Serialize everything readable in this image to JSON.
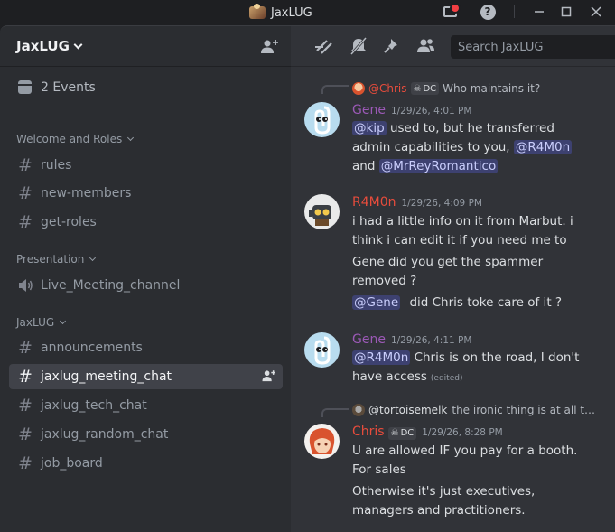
{
  "window": {
    "title": "JaxLUG"
  },
  "colors": {
    "sidebar_bg": "#2b2d31",
    "main_bg": "#313338",
    "accent_mention": "#5865f2",
    "gene_name": "#9b59b6",
    "r4m0n_name": "#e74c3c",
    "chris_name": "#e74c3c"
  },
  "sidebar": {
    "server_name": "JaxLUG",
    "events_label": "2 Events",
    "categories": [
      {
        "name": "Welcome and Roles"
      },
      {
        "name": "Presentation"
      },
      {
        "name": "JaxLUG"
      }
    ],
    "channels": [
      {
        "name": "rules",
        "icon": "hash-icon"
      },
      {
        "name": "new-members",
        "icon": "hash-icon"
      },
      {
        "name": "get-roles",
        "icon": "hash-icon"
      },
      {
        "name": "Live_Meeting_channel",
        "icon": "speaker-icon"
      },
      {
        "name": "announcements",
        "icon": "hash-icon"
      },
      {
        "name": "jaxlug_meeting_chat",
        "icon": "hash-icon",
        "active": true
      },
      {
        "name": "jaxlug_tech_chat",
        "icon": "hash-icon"
      },
      {
        "name": "jaxlug_random_chat",
        "icon": "hash-icon"
      },
      {
        "name": "job_board",
        "icon": "hash-icon"
      }
    ]
  },
  "toolbar": {
    "search_placeholder": "Search JaxLUG"
  },
  "messages": [
    {
      "reply": {
        "author": "@Chris",
        "tag": "DC",
        "text": "Who maintains it?"
      },
      "author": "Gene",
      "timestamp": "1/29/26, 4:01 PM",
      "mentions": [
        "@kip",
        "@R4M0n",
        "@MrReyRomantico"
      ],
      "lines": [
        "used to, but he transferred",
        "admin capabilities to you,",
        "and"
      ]
    },
    {
      "author": "R4M0n",
      "timestamp": "1/29/26, 4:09 PM",
      "lines": [
        "i had a little info on it from Marbut.   i",
        "think  i can edit it  if you need me to",
        "Gene  did you get the spammer",
        "removed ?",
        "did Chris  toke care of it ?"
      ],
      "mentions": [
        "@Gene"
      ]
    },
    {
      "author": "Gene",
      "timestamp": "1/29/26, 4:11 PM",
      "mentions": [
        "@R4M0n"
      ],
      "lines": [
        "Chris is on the road, I don't",
        "have access"
      ],
      "edited": "(edited)"
    },
    {
      "reply": {
        "author": "@tortoisemelk",
        "text": "the ironic thing is at all t…"
      },
      "author": "Chris",
      "tag": "DC",
      "timestamp": "1/29/26, 8:28 PM",
      "lines": [
        "U are allowed IF you pay for a booth.",
        "For sales",
        "Otherwise it's just executives,",
        "managers and practitioners."
      ]
    }
  ]
}
